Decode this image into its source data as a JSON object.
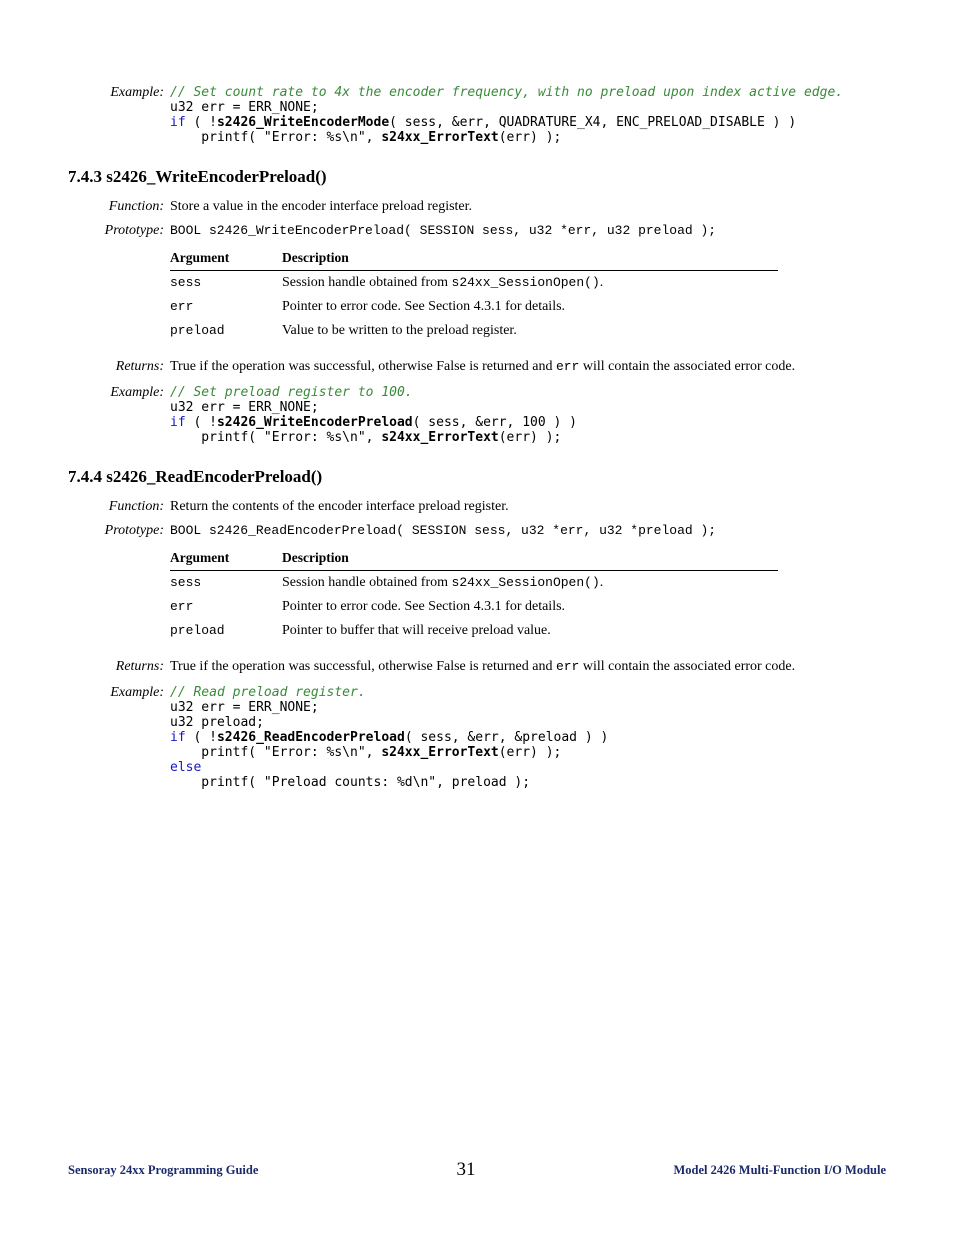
{
  "example1": {
    "label": "Example:",
    "comment": "// Set count rate to 4x the encoder frequency, with no preload upon index active edge.",
    "line2": "u32 err = ERR_NONE;",
    "line3_if": "if",
    "line3_rest1": " ( !",
    "line3_fn": "s2426_WriteEncoderMode",
    "line3_rest2": "( sess, &err, QUADRATURE_X4, ENC_PRELOAD_DISABLE ) )",
    "line4a": "    printf( \"Error: %s\\n\", ",
    "line4b": "s24xx_ErrorText",
    "line4c": "(err) );"
  },
  "section1": {
    "heading": "7.4.3  s2426_WriteEncoderPreload()",
    "functionLabel": "Function:",
    "functionText": "Store a value in the encoder interface preload register.",
    "prototypeLabel": "Prototype:",
    "prototypeText": "BOOL s2426_WriteEncoderPreload( SESSION sess, u32 *err, u32 preload );",
    "argHeader": "Argument",
    "descHeader": "Description",
    "arg1": "sess",
    "desc1a": "Session handle obtained from ",
    "desc1b": "s24xx_SessionOpen()",
    "desc1c": ".",
    "arg2": "err",
    "desc2": "Pointer to error code. See Section 4.3.1 for details.",
    "arg3": "preload",
    "desc3": "Value to be written to the preload register.",
    "returnsLabel": "Returns:",
    "returnsTextA": "True if the operation was successful, otherwise False is returned and ",
    "returnsCode": "err",
    "returnsTextB": " will contain the associated error code.",
    "exampleLabel": "Example:",
    "exComment": "// Set preload register to 100.",
    "exLine2": "u32 err = ERR_NONE;",
    "exLine3_if": "if",
    "exLine3_a": " ( !",
    "exLine3_fn": "s2426_WriteEncoderPreload",
    "exLine3_b": "( sess, &err, 100 ) )",
    "exLine4a": "    printf( \"Error: %s\\n\", ",
    "exLine4b": "s24xx_ErrorText",
    "exLine4c": "(err) );"
  },
  "section2": {
    "heading": "7.4.4  s2426_ReadEncoderPreload()",
    "functionLabel": "Function:",
    "functionText": "Return the contents of the encoder interface preload register.",
    "prototypeLabel": "Prototype:",
    "prototypeText": "BOOL s2426_ReadEncoderPreload( SESSION sess, u32 *err, u32 *preload );",
    "argHeader": "Argument",
    "descHeader": "Description",
    "arg1": "sess",
    "desc1a": "Session handle obtained from ",
    "desc1b": "s24xx_SessionOpen()",
    "desc1c": ".",
    "arg2": "err",
    "desc2": "Pointer to error code. See Section 4.3.1 for details.",
    "arg3": "preload",
    "desc3": "Pointer to buffer that will receive preload value.",
    "returnsLabel": "Returns:",
    "returnsTextA": "True if the operation was successful, otherwise False is returned and ",
    "returnsCode": "err",
    "returnsTextB": " will contain the associated error code.",
    "exampleLabel": "Example:",
    "exComment": "// Read preload register.",
    "exLine2": "u32 err = ERR_NONE;",
    "exLine3": "u32 preload;",
    "exLine4_if": "if",
    "exLine4_a": " ( !",
    "exLine4_fn": "s2426_ReadEncoderPreload",
    "exLine4_b": "( sess, &err, &preload ) )",
    "exLine5a": "    printf( \"Error: %s\\n\", ",
    "exLine5b": "s24xx_ErrorText",
    "exLine5c": "(err) );",
    "exLine6_else": "else",
    "exLine7": "    printf( \"Preload counts: %d\\n\", preload );"
  },
  "footer": {
    "left": "Sensoray 24xx Programming Guide",
    "pagenum": "31",
    "right": "Model 2426 Multi-Function I/O Module"
  }
}
